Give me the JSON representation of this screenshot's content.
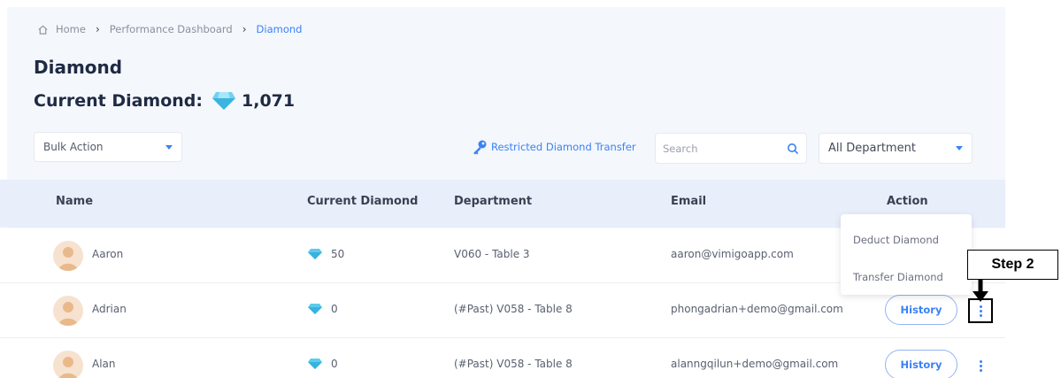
{
  "breadcrumb": {
    "home": "Home",
    "dashboard": "Performance Dashboard",
    "current": "Diamond"
  },
  "page": {
    "title": "Diamond",
    "current_label": "Current Diamond:",
    "current_value": "1,071"
  },
  "toolbar": {
    "bulk_action": "Bulk Action",
    "restricted_transfer": "Restricted Diamond Transfer",
    "search_placeholder": "Search",
    "department_filter": "All Department"
  },
  "table": {
    "headers": {
      "name": "Name",
      "diamond": "Current Diamond",
      "department": "Department",
      "email": "Email",
      "action": "Action"
    },
    "rows": [
      {
        "name": "Aaron",
        "diamond": "50",
        "department": "V060 - Table 3",
        "email": "aaron@vimigoapp.com",
        "history": "History"
      },
      {
        "name": "Adrian",
        "diamond": "0",
        "department": "(#Past) V058 - Table 8",
        "email": "phongadrian+demo@gmail.com",
        "history": "History"
      },
      {
        "name": "Alan",
        "diamond": "0",
        "department": "(#Past) V058 - Table 8",
        "email": "alanngqilun+demo@gmail.com",
        "history": "History"
      }
    ]
  },
  "action_menu": {
    "deduct": "Deduct Diamond",
    "transfer": "Transfer Diamond"
  },
  "annotation": {
    "step": "Step 2"
  },
  "colors": {
    "accent": "#3b82f6",
    "diamond": "#4fc3e8",
    "header_bg": "#e9eefb",
    "panel_bg": "#f4f7fc"
  },
  "icons": {
    "home": "home-icon",
    "key": "key-icon",
    "search": "search-icon",
    "diamond": "diamond-icon",
    "more": "more-vertical-icon"
  }
}
